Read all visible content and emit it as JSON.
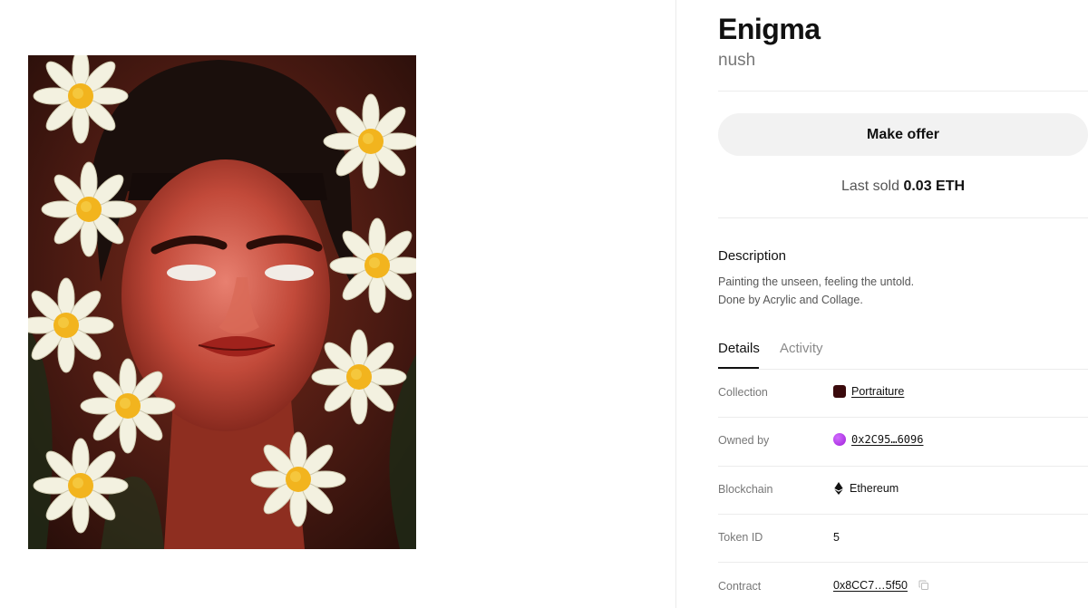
{
  "artwork": {
    "title": "Enigma",
    "artist": "nush"
  },
  "actions": {
    "make_offer": "Make offer"
  },
  "sale": {
    "last_sold_label": "Last sold",
    "last_sold_value": "0.03 ETH"
  },
  "description": {
    "heading": "Description",
    "lines": [
      "Painting the unseen, feeling the untold.",
      "Done by Acrylic and Collage."
    ]
  },
  "tabs": [
    {
      "label": "Details",
      "active": true
    },
    {
      "label": "Activity",
      "active": false
    }
  ],
  "details": {
    "collection_label": "Collection",
    "collection_value": "Portraiture",
    "owner_label": "Owned by",
    "owner_value": "0x2C95…6096",
    "blockchain_label": "Blockchain",
    "blockchain_value": "Ethereum",
    "token_label": "Token ID",
    "token_value": "5",
    "contract_label": "Contract",
    "contract_value": "0x8CC7…5f50"
  },
  "icons": {
    "collection": "collection-swatch-icon",
    "owner": "owner-avatar-icon",
    "blockchain": "ethereum-icon",
    "copy": "copy-icon"
  },
  "colors": {
    "collection_swatch": "#3a0a0c",
    "owner_avatar": "#b22fe6",
    "button_bg": "#f2f2f2"
  }
}
